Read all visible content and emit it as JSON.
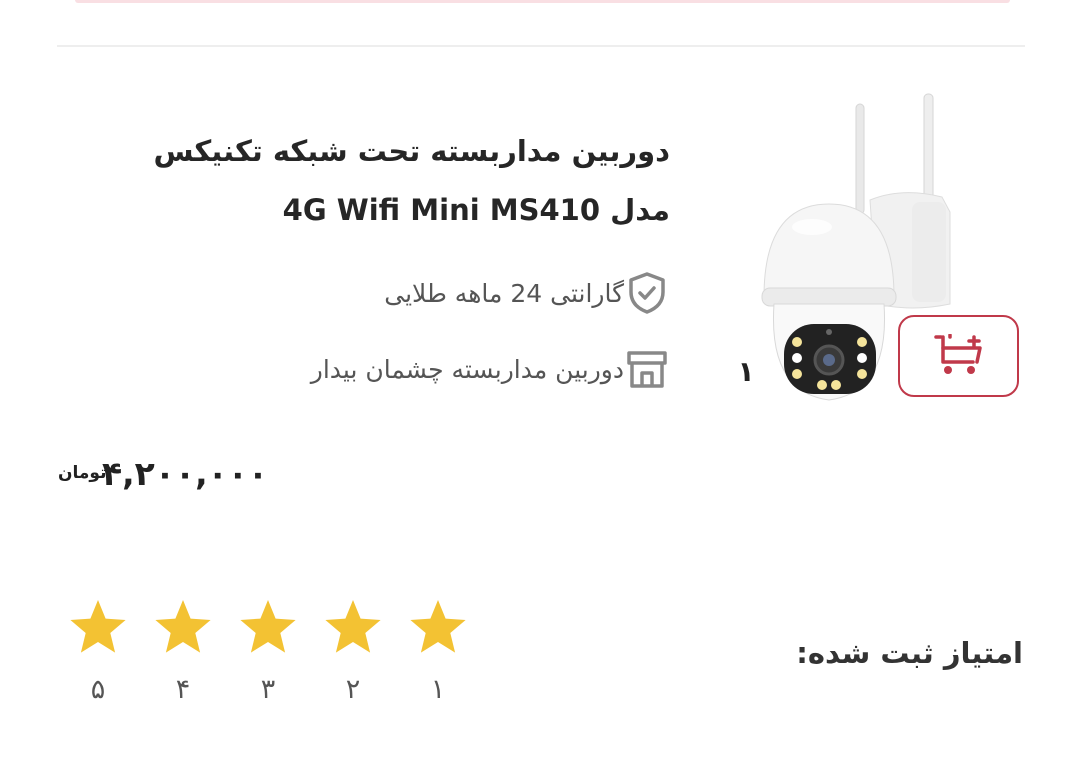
{
  "product": {
    "title_line1": "دوربین مداربسته تحت شبکه تکنیکس",
    "title_line2": "مدل 4G Wifi Mini MS410",
    "warranty": "گارانتی 24 ماهه طلایی",
    "seller": "دوربین مداربسته چشمان بیدار",
    "quantity": "۱",
    "price": "۴,۲۰۰,۰۰۰",
    "currency": "تومان",
    "image_icon": "security-camera-image"
  },
  "icons": {
    "cart": "add-to-cart-icon",
    "warranty": "shield-check-icon",
    "seller": "store-icon"
  },
  "colors": {
    "accent": "#c0394a",
    "star": "#f3c233"
  },
  "rating": {
    "label": "امتیاز ثبت شده:",
    "stars": [
      {
        "value": "۱"
      },
      {
        "value": "۲"
      },
      {
        "value": "۳"
      },
      {
        "value": "۴"
      },
      {
        "value": "۵"
      }
    ]
  }
}
